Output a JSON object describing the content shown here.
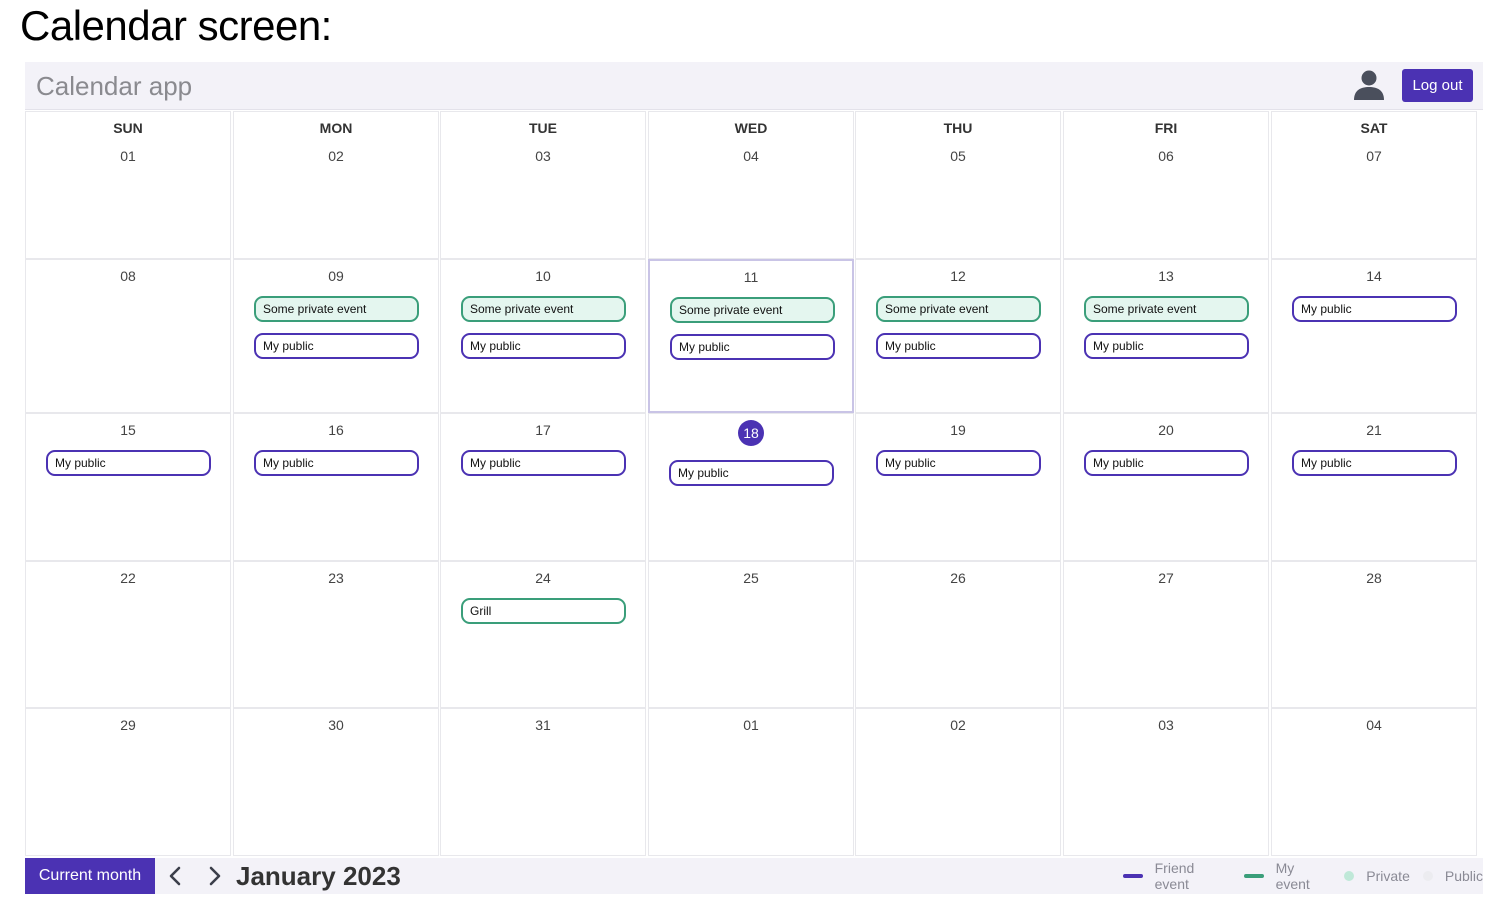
{
  "caption": "Calendar screen:",
  "app": {
    "title": "Calendar app",
    "logout_label": "Log out",
    "user_icon": "user-icon"
  },
  "colors": {
    "primary": "#4b32b3",
    "my_event": "#3a9e7a",
    "private_fill": "#e4f6ef",
    "public_dot": "#ececf0"
  },
  "weekdays": [
    "SUN",
    "MON",
    "TUE",
    "WED",
    "THU",
    "FRI",
    "SAT"
  ],
  "today": "18",
  "weeks": [
    [
      {
        "day": "01",
        "events": []
      },
      {
        "day": "02",
        "events": []
      },
      {
        "day": "03",
        "events": []
      },
      {
        "day": "04",
        "events": []
      },
      {
        "day": "05",
        "events": []
      },
      {
        "day": "06",
        "events": []
      },
      {
        "day": "07",
        "events": []
      }
    ],
    [
      {
        "day": "08",
        "events": []
      },
      {
        "day": "09",
        "events": [
          {
            "title": "Some private event",
            "kind": "mine-private"
          },
          {
            "title": "My public",
            "kind": "friend"
          }
        ]
      },
      {
        "day": "10",
        "events": [
          {
            "title": "Some private event",
            "kind": "mine-private"
          },
          {
            "title": "My public",
            "kind": "friend"
          }
        ]
      },
      {
        "day": "11",
        "events": [
          {
            "title": "Some private event",
            "kind": "mine-private"
          },
          {
            "title": "My public",
            "kind": "friend"
          }
        ]
      },
      {
        "day": "12",
        "events": [
          {
            "title": "Some private event",
            "kind": "mine-private"
          },
          {
            "title": "My public",
            "kind": "friend"
          }
        ]
      },
      {
        "day": "13",
        "events": [
          {
            "title": "Some private event",
            "kind": "mine-private"
          },
          {
            "title": "My public",
            "kind": "friend"
          }
        ]
      },
      {
        "day": "14",
        "events": [
          {
            "title": "My public",
            "kind": "friend"
          }
        ]
      }
    ],
    [
      {
        "day": "15",
        "events": [
          {
            "title": "My public",
            "kind": "friend"
          }
        ]
      },
      {
        "day": "16",
        "events": [
          {
            "title": "My public",
            "kind": "friend"
          }
        ]
      },
      {
        "day": "17",
        "events": [
          {
            "title": "My public",
            "kind": "friend"
          }
        ]
      },
      {
        "day": "18",
        "events": [
          {
            "title": "My public",
            "kind": "friend"
          }
        ]
      },
      {
        "day": "19",
        "events": [
          {
            "title": "My public",
            "kind": "friend"
          }
        ]
      },
      {
        "day": "20",
        "events": [
          {
            "title": "My public",
            "kind": "friend"
          }
        ]
      },
      {
        "day": "21",
        "events": [
          {
            "title": "My public",
            "kind": "friend"
          }
        ]
      }
    ],
    [
      {
        "day": "22",
        "events": []
      },
      {
        "day": "23",
        "events": []
      },
      {
        "day": "24",
        "events": [
          {
            "title": "Grill",
            "kind": "mine-public"
          }
        ]
      },
      {
        "day": "25",
        "events": []
      },
      {
        "day": "26",
        "events": []
      },
      {
        "day": "27",
        "events": []
      },
      {
        "day": "28",
        "events": []
      }
    ],
    [
      {
        "day": "29",
        "events": []
      },
      {
        "day": "30",
        "events": []
      },
      {
        "day": "31",
        "events": []
      },
      {
        "day": "01",
        "events": []
      },
      {
        "day": "02",
        "events": []
      },
      {
        "day": "03",
        "events": []
      },
      {
        "day": "04",
        "events": []
      }
    ]
  ],
  "footer": {
    "current_month_label": "Current month",
    "prev_icon": "chevron-left-icon",
    "next_icon": "chevron-right-icon",
    "month_title": "January 2023",
    "legend": [
      {
        "label": "Friend event",
        "type": "line",
        "color": "#4b32b3"
      },
      {
        "label": "My event",
        "type": "line",
        "color": "#3a9e7a"
      },
      {
        "label": "Private",
        "type": "dot",
        "color": "#bfe8d8"
      },
      {
        "label": "Public",
        "type": "dot",
        "color": "#ececf0"
      }
    ]
  }
}
